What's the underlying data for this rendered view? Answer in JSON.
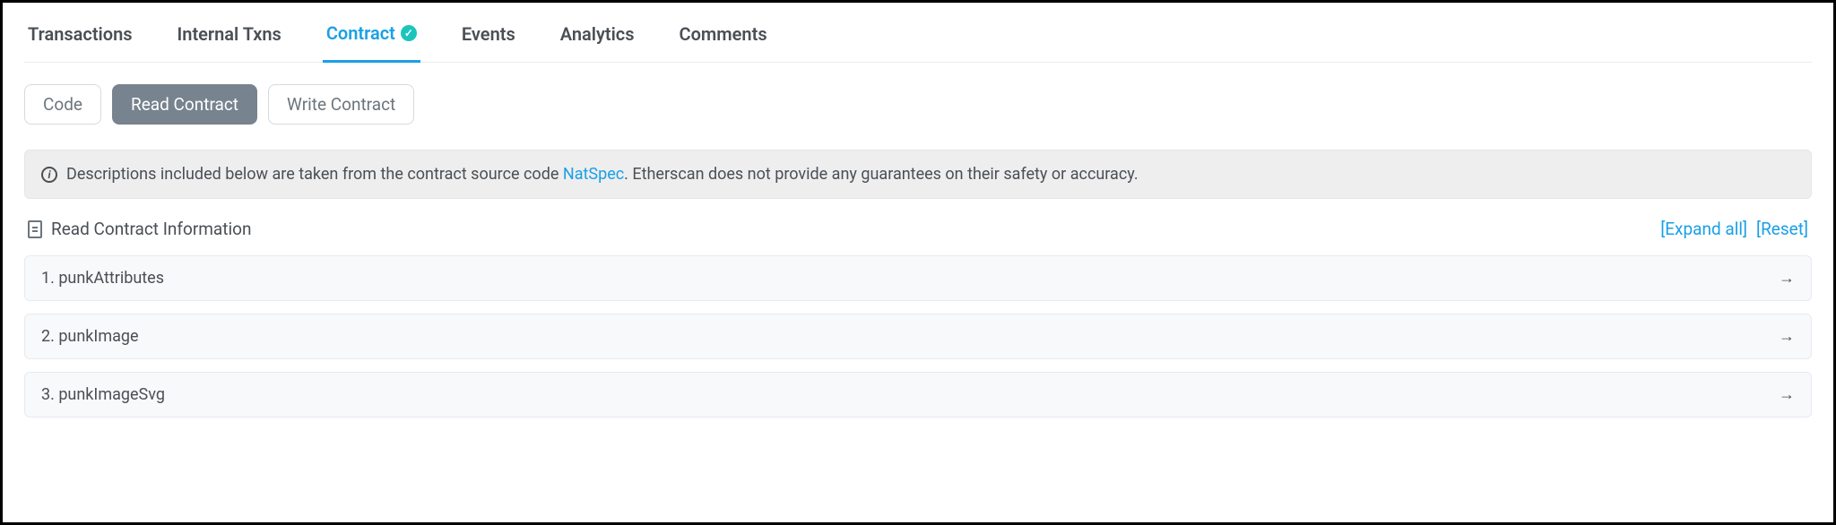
{
  "tabs": {
    "transactions": "Transactions",
    "internal": "Internal Txns",
    "contract": "Contract",
    "events": "Events",
    "analytics": "Analytics",
    "comments": "Comments"
  },
  "subtabs": {
    "code": "Code",
    "read": "Read Contract",
    "write": "Write Contract"
  },
  "banner": {
    "prefix": "Descriptions included below are taken from the contract source code ",
    "link": "NatSpec",
    "suffix": ". Etherscan does not provide any guarantees on their safety or accuracy."
  },
  "section": {
    "title": "Read Contract Information",
    "expand": "[Expand all]",
    "reset": "[Reset]"
  },
  "functions": [
    {
      "label": "1. punkAttributes"
    },
    {
      "label": "2. punkImage"
    },
    {
      "label": "3. punkImageSvg"
    }
  ]
}
